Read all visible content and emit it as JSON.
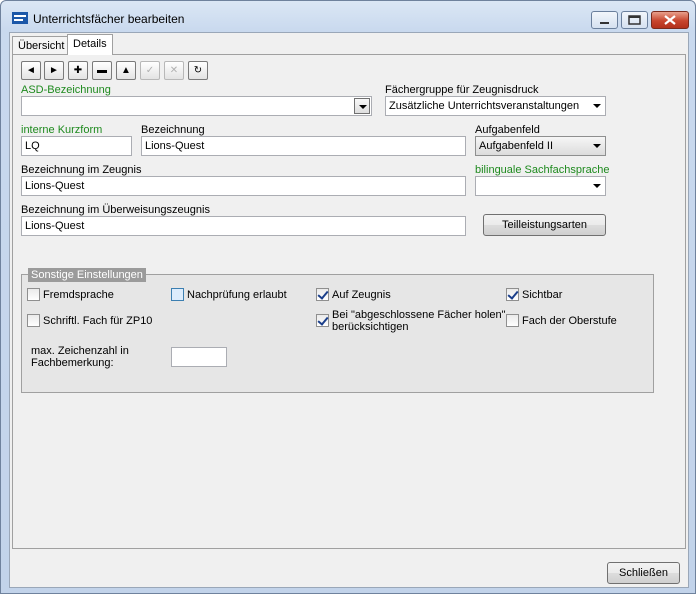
{
  "window": {
    "title": "Unterrichtsfächer bearbeiten",
    "icons": {
      "app": "table-icon",
      "minimize": "minimize-icon",
      "maximize": "maximize-icon",
      "close": "close-icon"
    }
  },
  "tabs": [
    {
      "label": "Übersicht",
      "active": false
    },
    {
      "label": "Details",
      "active": true
    }
  ],
  "toolbar": [
    {
      "icon": "arrow-left-icon",
      "glyph": "◄",
      "enabled": true
    },
    {
      "icon": "arrow-right-icon",
      "glyph": "►",
      "enabled": true
    },
    {
      "icon": "plus-icon",
      "glyph": "✚",
      "enabled": true
    },
    {
      "icon": "minus-icon",
      "glyph": "▬",
      "enabled": true
    },
    {
      "icon": "arrow-up-icon",
      "glyph": "▲",
      "enabled": true
    },
    {
      "icon": "check-icon",
      "glyph": "✓",
      "enabled": false
    },
    {
      "icon": "cancel-icon",
      "glyph": "✕",
      "enabled": false
    },
    {
      "icon": "refresh-icon",
      "glyph": "↻",
      "enabled": true
    }
  ],
  "form": {
    "asd": {
      "label": "ASD-Bezeichnung",
      "value": ""
    },
    "faechergruppe": {
      "label": "Fächergruppe für Zeugnisdruck",
      "value": "Zusätzliche Unterrichtsveranstaltungen"
    },
    "kurzform": {
      "label": "interne Kurzform",
      "value": "LQ"
    },
    "bezeichnung": {
      "label": "Bezeichnung",
      "value": "Lions-Quest"
    },
    "aufgabenfeld": {
      "label": "Aufgabenfeld",
      "value": "Aufgabenfeld II"
    },
    "zeugnis": {
      "label": "Bezeichnung im Zeugnis",
      "value": "Lions-Quest"
    },
    "bilingual": {
      "label": "bilinguale Sachfachsprache",
      "value": ""
    },
    "ueberweisung": {
      "label": "Bezeichnung im Überweisungszeugnis",
      "value": "Lions-Quest"
    },
    "teilleistung_button": "Teilleistungsarten"
  },
  "settings": {
    "legend": "Sonstige Einstellungen",
    "fremdsprache": {
      "label": "Fremdsprache",
      "checked": false
    },
    "nachpruefung": {
      "label": "Nachprüfung erlaubt",
      "checked": false
    },
    "auf_zeugnis": {
      "label": "Auf Zeugnis",
      "checked": true
    },
    "sichtbar": {
      "label": "Sichtbar",
      "checked": true
    },
    "schriftl": {
      "label": "Schriftl. Fach für ZP10",
      "checked": false
    },
    "abgeschlossen": {
      "label": "Bei \"abgeschlossene Fächer holen\" berücksichtigen",
      "checked": true
    },
    "oberstufe": {
      "label": "Fach der Oberstufe",
      "checked": false
    },
    "max_zeichen": {
      "label": "max. Zeichenzahl in Fachbemerkung:",
      "value": ""
    }
  },
  "footer": {
    "close_label": "Schließen"
  }
}
